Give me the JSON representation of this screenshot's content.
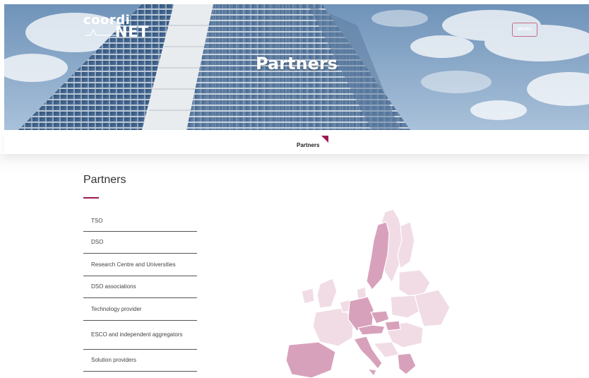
{
  "header": {
    "logo_line1": "coordi",
    "logo_line2": "NET",
    "menu_label": "MENU",
    "hero_title": "Partners"
  },
  "breadcrumb": {
    "current": "Partners"
  },
  "colors": {
    "accent": "#9b1b53",
    "map_dark": "#d8a1bb",
    "map_light": "#f1dce6"
  },
  "main": {
    "title": "Partners",
    "categories": [
      "TSO",
      "DSO",
      "Research Centre and Universities",
      "DSO associations",
      "Technology provider",
      "ESCO and independent aggregators",
      "Solution providers"
    ]
  }
}
